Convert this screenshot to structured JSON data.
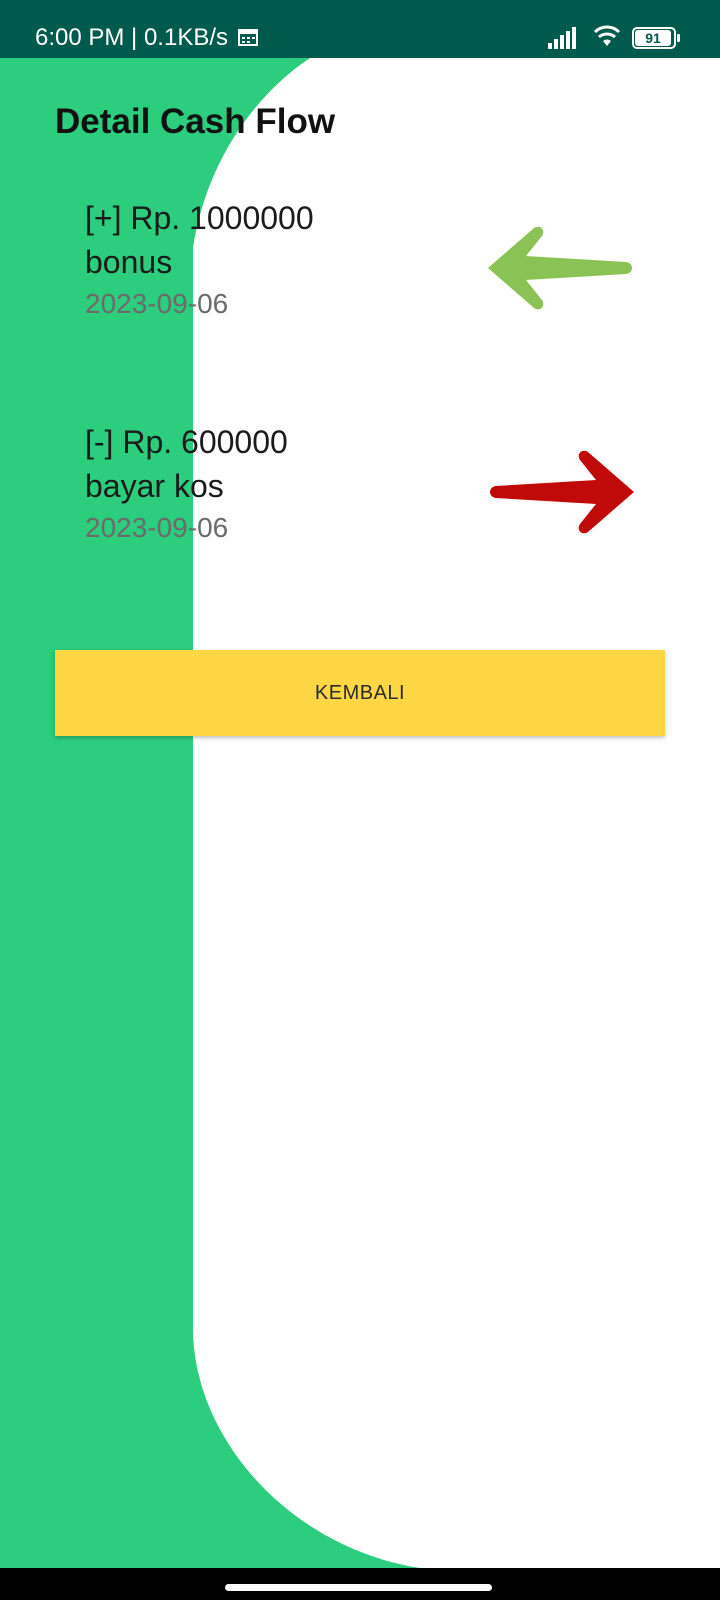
{
  "status_bar": {
    "time_speed": "6:00 PM | 0.1KB/s",
    "battery_level": "91",
    "icons": [
      "calendar-icon",
      "signal-icon",
      "wifi-icon",
      "battery-icon"
    ]
  },
  "page": {
    "title": "Detail Cash Flow"
  },
  "entries": [
    {
      "amount": "[+] Rp. 1000000",
      "description": "bonus",
      "date": "2023-09-06",
      "arrow_icon": "arrow-left-icon",
      "arrow_color": "#8bc255"
    },
    {
      "amount": "[-] Rp. 600000",
      "description": "bayar kos",
      "date": "2023-09-06",
      "arrow_icon": "arrow-right-icon",
      "arrow_color": "#c00a0a"
    }
  ],
  "button": {
    "label": "KEMBALI",
    "color": "#fdd844"
  },
  "colors": {
    "status_bar": "#005a4d",
    "background_green": "#2ccd7c",
    "background_white": "#ffffff"
  }
}
